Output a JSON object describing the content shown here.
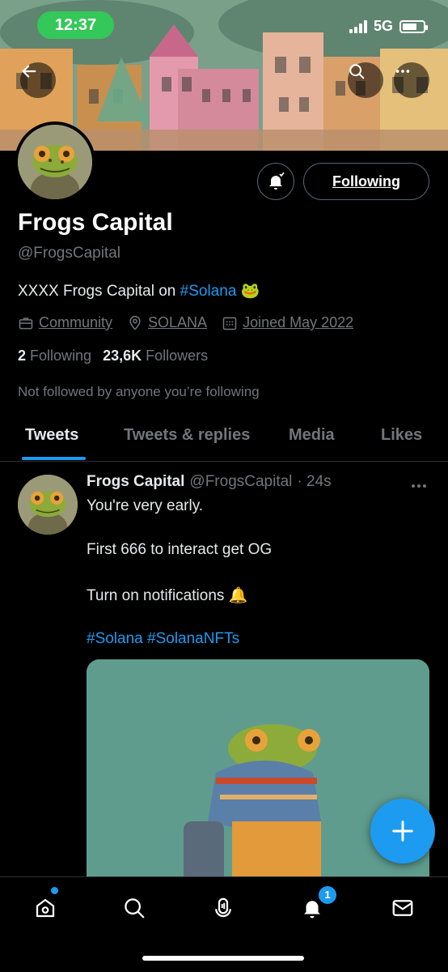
{
  "status_bar": {
    "time": "12:37",
    "network": "5G"
  },
  "profile": {
    "name": "Frogs Capital",
    "handle": "@FrogsCapital",
    "bio_text": "XXXX Frogs Capital on ",
    "bio_hashtag": "#Solana",
    "bio_emoji": "🐸",
    "category": "Community",
    "location": "SOLANA",
    "joined": "Joined May 2022",
    "following_count": "2",
    "following_label": "Following",
    "followers_count": "23,6K",
    "followers_label": "Followers",
    "not_followed_text": "Not followed by anyone you’re following",
    "follow_button_label": "Following"
  },
  "tabs": [
    "Tweets",
    "Tweets & replies",
    "Media",
    "Likes"
  ],
  "tweet": {
    "author_name": "Frogs Capital",
    "author_handle": "@FrogsCapital",
    "time": "· 24s",
    "line1": "You're very early.",
    "line2": "First 666 to interact get OG",
    "line3": "Turn on notifications 🔔",
    "hashtags": "#Solana #SolanaNFTs"
  },
  "nav": {
    "notifications_badge": "1"
  },
  "colors": {
    "accent": "#1d9bf0",
    "background": "#000000",
    "muted": "#71767b",
    "status_pill": "#34c759"
  },
  "icons": [
    "back-arrow-icon",
    "search-icon",
    "more-icon",
    "bell-notification-icon",
    "briefcase-icon",
    "location-pin-icon",
    "calendar-icon",
    "compose-plus-icon",
    "home-icon",
    "explore-search-icon",
    "spaces-icon",
    "notifications-bell-icon",
    "messages-mail-icon"
  ]
}
